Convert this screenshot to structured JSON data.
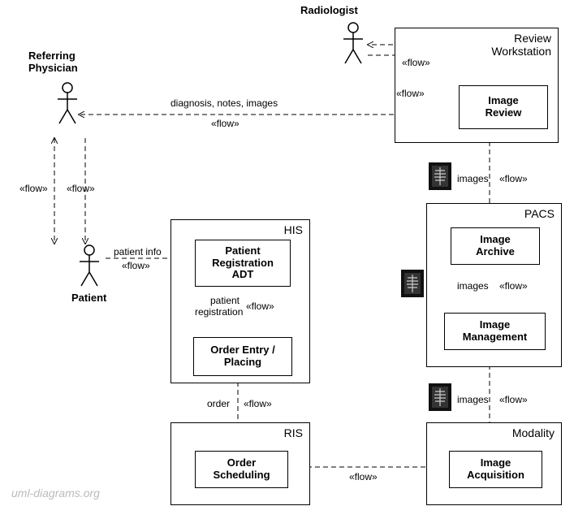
{
  "actors": {
    "radiologist": "Radiologist",
    "referring_physician": "Referring\nPhysician",
    "patient": "Patient"
  },
  "containers": {
    "review_ws": "Review\nWorkstation",
    "his": "HIS",
    "pacs": "PACS",
    "ris": "RIS",
    "modality": "Modality"
  },
  "boxes": {
    "image_review": "Image\nReview",
    "patient_reg": "Patient\nRegistration\nADT",
    "order_entry": "Order Entry /\nPlacing",
    "image_archive": "Image\nArchive",
    "image_mgmt": "Image\nManagement",
    "order_sched": "Order\nScheduling",
    "image_acq": "Image\nAcquisition"
  },
  "flows": {
    "dni": "diagnosis, notes, images",
    "patient_info": "patient info",
    "patient_reg": "patient\nregistration",
    "order": "order",
    "images": "images",
    "stereo": "«flow»"
  },
  "watermark": "uml-diagrams.org"
}
